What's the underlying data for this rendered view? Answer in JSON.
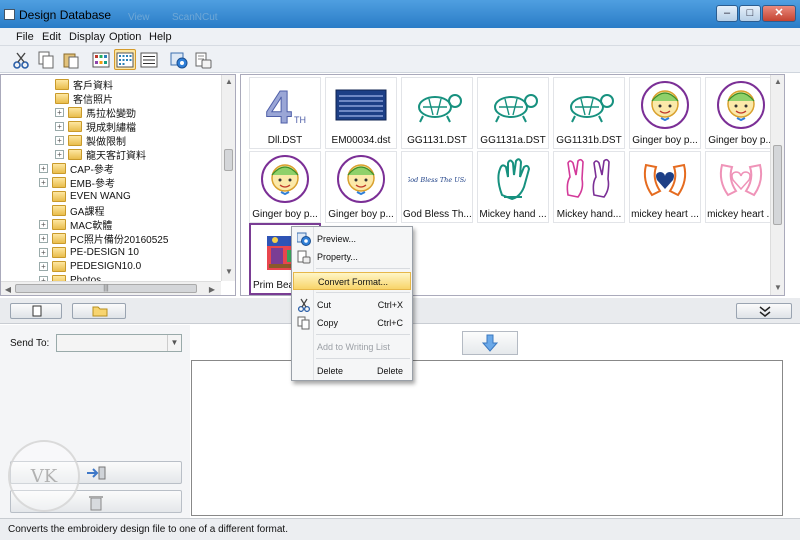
{
  "window": {
    "title": "Design Database",
    "faint_menu": [
      "View",
      "ScanNCut"
    ],
    "controls": [
      "minimize-button",
      "maximize-button",
      "close-button"
    ]
  },
  "menu": [
    "File",
    "Edit",
    "Display",
    "Option",
    "Help"
  ],
  "toolbar_icons": [
    "cut-icon",
    "copy-icon",
    "paste-icon",
    "large-thumbnail-icon",
    "small-thumbnail-icon",
    "list-view-icon",
    "preview-icon",
    "property-icon"
  ],
  "tree": {
    "items": [
      {
        "label": "客戶資料",
        "level": 2,
        "expander": false
      },
      {
        "label": "客信照片",
        "level": 2,
        "expander": false
      },
      {
        "label": "馬拉松變勁",
        "level": 2,
        "expander": true
      },
      {
        "label": "現成刺繡檔",
        "level": 2,
        "expander": true
      },
      {
        "label": "製做限制",
        "level": 2,
        "expander": true
      },
      {
        "label": "龍天客訂資料",
        "level": 2,
        "expander": true
      },
      {
        "label": "CAP-參考",
        "level": 1,
        "expander": true
      },
      {
        "label": "EMB-參考",
        "level": 1,
        "expander": true
      },
      {
        "label": "EVEN WANG",
        "level": 1,
        "expander": false
      },
      {
        "label": "GA課程",
        "level": 1,
        "expander": false
      },
      {
        "label": "MAC軟體",
        "level": 1,
        "expander": true
      },
      {
        "label": "PC照片備份20160525",
        "level": 1,
        "expander": true
      },
      {
        "label": "PE-DESIGN 10",
        "level": 1,
        "expander": true
      },
      {
        "label": "PEDESIGN10.0",
        "level": 1,
        "expander": true
      },
      {
        "label": "Photos",
        "level": 1,
        "expander": true
      }
    ],
    "hscroll_grip": "|||"
  },
  "designs": [
    {
      "label": "Dll.DST",
      "art": "number-4-art",
      "text": "4"
    },
    {
      "label": "EM00034.dst",
      "art": "flag-art"
    },
    {
      "label": "GG1131.DST",
      "art": "turtle-art"
    },
    {
      "label": "GG1131a.DST",
      "art": "turtle-art"
    },
    {
      "label": "GG1131b.DST",
      "art": "turtle-art"
    },
    {
      "label": "Ginger boy p...",
      "art": "ginger-boy-art"
    },
    {
      "label": "Ginger boy p...",
      "art": "ginger-boy-art"
    },
    {
      "label": "Ginger boy p...",
      "art": "ginger-boy-art"
    },
    {
      "label": "Ginger boy p...",
      "art": "ginger-boy-art"
    },
    {
      "label": "God Bless Th...",
      "art": "script-text-art",
      "text": "God Bless The USA"
    },
    {
      "label": "Mickey hand ...",
      "art": "mickey-hand-art"
    },
    {
      "label": "Mickey hand...",
      "art": "mickey-peace-hand-art"
    },
    {
      "label": "mickey heart ...",
      "art": "mickey-heart-art"
    },
    {
      "label": "mickey heart ...",
      "art": "mickey-heart-pink-art"
    },
    {
      "label": "Prim Bear",
      "art": "prim-bear-art",
      "selected": true
    }
  ],
  "context_menu": {
    "items": [
      {
        "label": "Preview...",
        "shortcut": "",
        "icon": "preview-icon",
        "disabled": false,
        "highlight": false
      },
      {
        "label": "Property...",
        "shortcut": "",
        "icon": "property-icon",
        "disabled": false,
        "highlight": false
      },
      {
        "label": "Convert Format...",
        "shortcut": "",
        "icon": "",
        "disabled": false,
        "highlight": true
      },
      {
        "label": "Cut",
        "shortcut": "Ctrl+X",
        "icon": "cut-icon",
        "disabled": false,
        "highlight": false
      },
      {
        "label": "Copy",
        "shortcut": "Ctrl+C",
        "icon": "copy-icon",
        "disabled": false,
        "highlight": false
      },
      {
        "label": "Add to Writing List",
        "shortcut": "",
        "icon": "",
        "disabled": true,
        "highlight": false
      },
      {
        "label": "Delete",
        "shortcut": "Delete",
        "icon": "",
        "disabled": false,
        "highlight": false
      }
    ]
  },
  "send_to": {
    "label": "Send To:",
    "value": ""
  },
  "status": "Converts the embroidery design file to one of a different format.",
  "watermark": "VK"
}
